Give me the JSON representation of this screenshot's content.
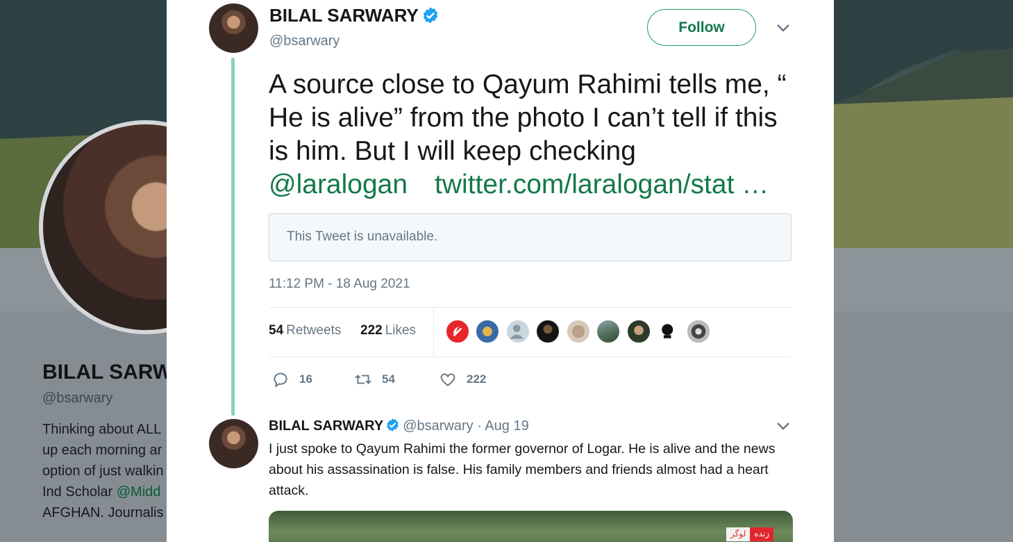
{
  "background": {
    "name": "BILAL SARW",
    "handle": "@bsarwary",
    "bio_lines": [
      {
        "text": "Thinking about ALL",
        "link": ""
      },
      {
        "text": "up each morning ar",
        "link": ""
      },
      {
        "text": "option of just walkin",
        "link": ""
      },
      {
        "text": "Ind Scholar ",
        "link": "@Midd"
      },
      {
        "text": "AFGHAN. Journalis",
        "link": ""
      }
    ]
  },
  "tweet": {
    "author_name": "BILAL SARWARY",
    "author_handle": "@bsarwary",
    "follow_label": "Follow",
    "text": "A source close to Qayum Rahimi tells me, “ He is alive” from the photo I can’t tell if this is him. But I will keep checking ",
    "mention": "@laralogan",
    "link": "twitter.com/laralogan/stat …",
    "quote_text": "This Tweet is unavailable.",
    "timestamp": "11:12 PM - 18 Aug 2021",
    "retweets_count": "54",
    "retweets_label": "Retweets",
    "likes_count": "222",
    "likes_label": "Likes",
    "actions": {
      "replies": "16",
      "retweets": "54",
      "likes": "222"
    }
  },
  "reply": {
    "author_name": "BILAL SARWARY",
    "meta": "@bsarwary · Aug 19",
    "text": "I just spoke to Qayum Rahimi the former governor of Logar. He is alive and the news about his assassination is false. His family members and friends almost had a heart attack.",
    "media_badge_live": "زنده",
    "media_badge_place": "لوگر"
  },
  "colors": {
    "accent_green": "#13784a",
    "thread_line": "#89d3b0",
    "verified_blue": "#1da1f2",
    "muted": "#657786"
  },
  "icons": [
    "verified-badge-icon",
    "chevron-down-icon",
    "reply-icon",
    "retweet-icon",
    "like-heart-icon"
  ]
}
